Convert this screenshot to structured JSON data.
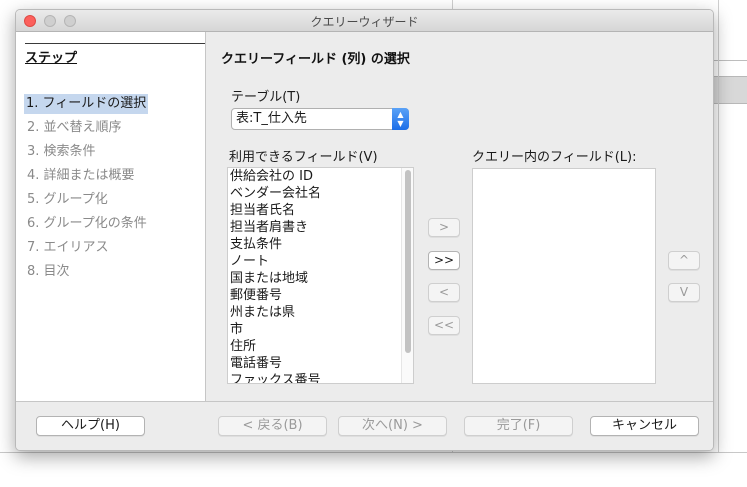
{
  "window": {
    "title": "クエリーウィザード"
  },
  "steps": {
    "heading": "ステップ",
    "items": [
      {
        "label": "1. フィールドの選択",
        "active": true
      },
      {
        "label": "2. 並べ替え順序",
        "active": false
      },
      {
        "label": "3. 検索条件",
        "active": false
      },
      {
        "label": "4. 詳細または概要",
        "active": false
      },
      {
        "label": "5. グループ化",
        "active": false
      },
      {
        "label": "6. グループ化の条件",
        "active": false
      },
      {
        "label": "7. エイリアス",
        "active": false
      },
      {
        "label": "8. 目次",
        "active": false
      }
    ]
  },
  "main": {
    "title": "クエリーフィールド (列) の選択",
    "table_label": "テーブル(T)",
    "table_value": "表:T_仕入先",
    "available_label": "利用できるフィールド(V)",
    "available_fields": [
      "供給会社の ID",
      "ベンダー会社名",
      "担当者氏名",
      "担当者肩書き",
      "支払条件",
      "ノート",
      "国または地域",
      "郵便番号",
      "州または県",
      "市",
      "住所",
      "電話番号",
      "ファックス番号"
    ],
    "query_label": "クエリー内のフィールド(L):",
    "query_fields": [],
    "move_buttons": {
      "add_one": ">",
      "add_all": ">>",
      "remove_one": "<",
      "remove_all": "<<",
      "up": "^",
      "down": "V"
    }
  },
  "footer": {
    "help": "ヘルプ(H)",
    "back": "< 戻る(B)",
    "next": "次へ(N) >",
    "finish": "完了(F)",
    "cancel": "キャンセル"
  },
  "colors": {
    "selection": "#c5d7ee",
    "close_button": "#fc605c",
    "select_arrow": "#1c6ee8"
  }
}
